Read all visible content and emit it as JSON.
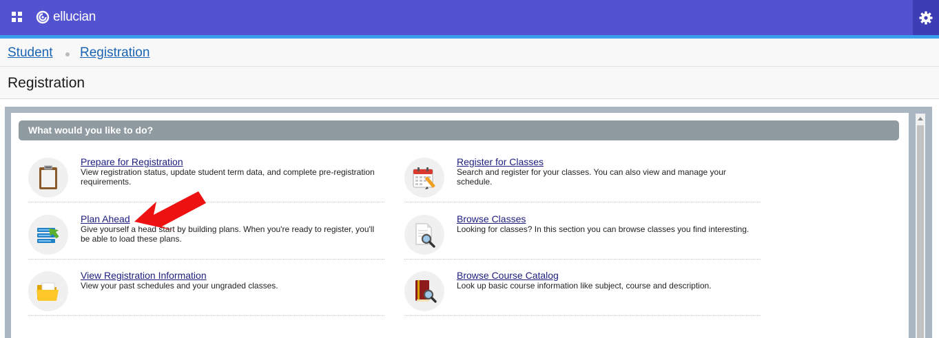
{
  "header": {
    "brand": "ellucian",
    "brand_color": "#5353d1",
    "accent_color": "#3aa0ee",
    "apps_icon": "grid-apps-icon",
    "settings_icon": "gear-icon"
  },
  "breadcrumb": {
    "items": [
      "Student",
      "Registration"
    ]
  },
  "page": {
    "title": "Registration"
  },
  "panel": {
    "header": "What would you like to do?",
    "tasks": [
      {
        "title": "Prepare for Registration",
        "description": "View registration status, update student term data, and complete pre-registration requirements.",
        "icon": "clipboard-icon"
      },
      {
        "title": "Register for Classes",
        "description": "Search and register for your classes. You can also view and manage your schedule.",
        "icon": "calendar-edit-icon"
      },
      {
        "title": "Plan Ahead",
        "description": "Give yourself a head start by building plans. When you're ready to register, you'll be able to load these plans.",
        "icon": "plan-list-icon"
      },
      {
        "title": "Browse Classes",
        "description": "Looking for classes? In this section you can browse classes you find interesting.",
        "icon": "document-search-icon"
      },
      {
        "title": "View Registration Information",
        "description": "View your past schedules and your ungraded classes.",
        "icon": "folder-icon"
      },
      {
        "title": "Browse Course Catalog",
        "description": "Look up basic course information like subject, course and description.",
        "icon": "book-search-icon"
      }
    ]
  },
  "annotation": {
    "icon": "red-arrow-icon",
    "color": "#ee1111"
  }
}
